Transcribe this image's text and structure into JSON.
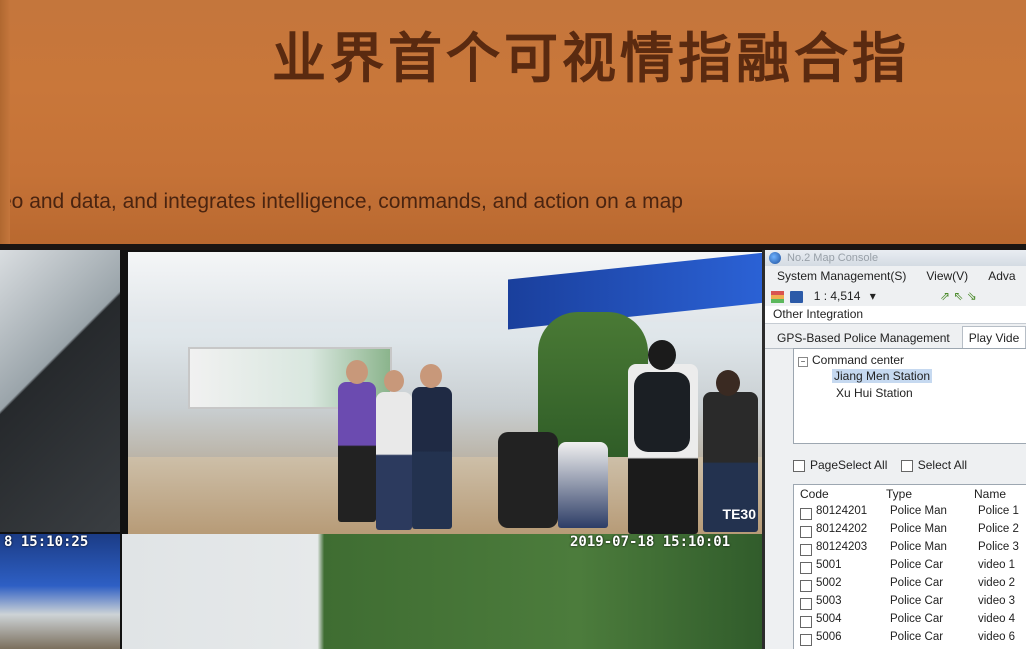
{
  "banner": {
    "chinese_headline": "业界首个可视情指融合指",
    "english_line": "eo and data, and integrates intelligence, commands, and action on a map"
  },
  "video_wall": {
    "main_tile_label": "TE30",
    "bottom_left_timestamp": "8 15:10:25",
    "bottom_center_timestamp": "2019-07-18 15:10:01"
  },
  "console": {
    "window_title": "No.2 Map Console",
    "menu": [
      "System Management(S)",
      "View(V)",
      "Adva"
    ],
    "scale": "1 : 4,514",
    "section_title": "Other Integration",
    "tabs": [
      "GPS-Based Police Management",
      "Play Vide"
    ],
    "tree": {
      "root": "Command center",
      "children": [
        "Jiang Men Station",
        "Xu Hui Station"
      ],
      "selected": "Jiang Men Station"
    },
    "page_select_all": "PageSelect All",
    "select_all": "Select All",
    "columns": [
      "Code",
      "Type",
      "Name"
    ],
    "rows": [
      {
        "code": "80124201",
        "type": "Police Man",
        "name": "Police 1"
      },
      {
        "code": "80124202",
        "type": "Police Man",
        "name": "Police 2"
      },
      {
        "code": "80124203",
        "type": "Police Man",
        "name": "Police 3"
      },
      {
        "code": "5001",
        "type": "Police Car",
        "name": "video 1"
      },
      {
        "code": "5002",
        "type": "Police Car",
        "name": "video 2"
      },
      {
        "code": "5003",
        "type": "Police Car",
        "name": "video 3"
      },
      {
        "code": "5004",
        "type": "Police Car",
        "name": "video 4"
      },
      {
        "code": "5006",
        "type": "Police Car",
        "name": "video 6"
      }
    ]
  },
  "colors": {
    "banner_orange": "#c4763c",
    "banner_text": "#5a2a10",
    "selection_blue": "#c6d9f0"
  }
}
